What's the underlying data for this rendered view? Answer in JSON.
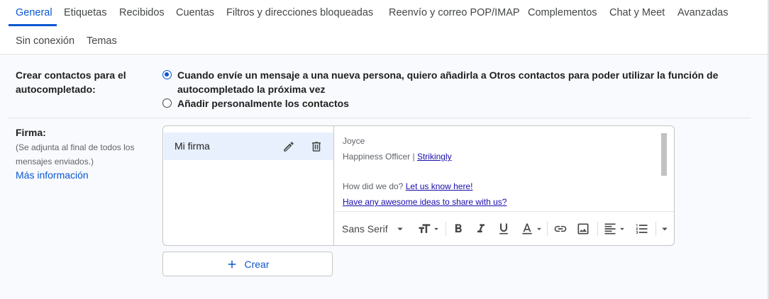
{
  "tabs": [
    {
      "label": "General",
      "active": true
    },
    {
      "label": "Etiquetas"
    },
    {
      "label": "Recibidos"
    },
    {
      "label": "Cuentas"
    },
    {
      "label": "Filtros y direcciones bloqueadas"
    },
    {
      "label": "Reenvío y correo POP/IMAP"
    },
    {
      "label": "Complementos"
    },
    {
      "label": "Chat y Meet"
    },
    {
      "label": "Avanzadas"
    },
    {
      "label": "Sin conexión"
    },
    {
      "label": "Temas"
    }
  ],
  "contacts": {
    "label_line1": "Crear contactos para el",
    "label_line2": "autocompletado:",
    "option1_line1": "Cuando envíe un mensaje a una nueva persona, quiero añadirla a Otros contactos para poder utilizar la función de",
    "option1_line2": "autocompletado la próxima vez",
    "option2": "Añadir personalmente los contactos",
    "selected": 1
  },
  "signature": {
    "label": "Firma:",
    "note_line1": "(Se adjunta al final de todos los",
    "note_line2": "mensajes enviados.)",
    "more_info": "Más información",
    "items": [
      {
        "name": "Mi firma"
      }
    ],
    "content": {
      "name": "Joyce",
      "title": "Happiness Officer | ",
      "company": "Strikingly",
      "question": "How did we do? ",
      "question_link": "Let us know here!",
      "ideas": "Have any awesome ideas to share with us?"
    },
    "toolbar": {
      "font": "Sans Serif"
    },
    "create_label": "Crear"
  },
  "colors": {
    "accent": "#0b57d0",
    "selected_bg": "#e8f0fe"
  }
}
